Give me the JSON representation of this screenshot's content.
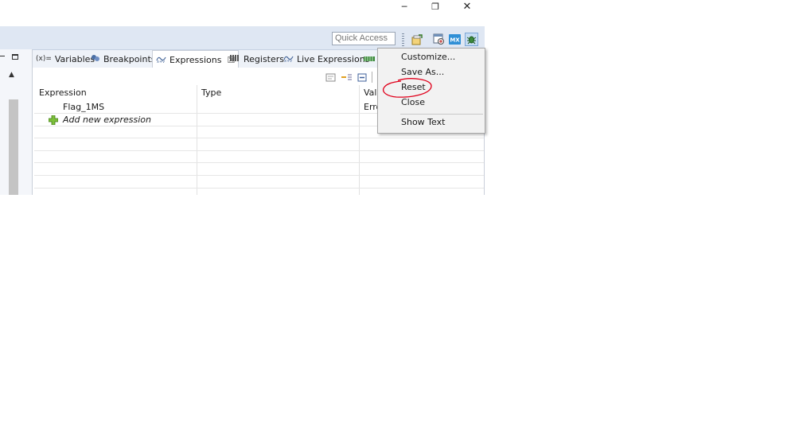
{
  "window": {
    "minimize_glyph": "─",
    "restore_glyph": "❐",
    "close_glyph": "✕"
  },
  "toolbar": {
    "quick_access_placeholder": "Quick Access"
  },
  "tabs": [
    {
      "prefix": "(x)=",
      "label": "Variables"
    },
    {
      "label": "Breakpoints"
    },
    {
      "label": "Expressions",
      "close_glyph": "☒"
    },
    {
      "label": "Registers"
    },
    {
      "label": "Live Expressions"
    }
  ],
  "table": {
    "headers": [
      "Expression",
      "Type",
      "Valu"
    ],
    "rows": [
      {
        "expression": "Flag_1MS",
        "type": "",
        "value": "Erro"
      }
    ],
    "add_new": "Add new expression"
  },
  "menu": {
    "items": [
      "Customize...",
      "Save As...",
      "Reset",
      "Close",
      "Show Text"
    ]
  },
  "colors": {
    "annotation": "#e0001b",
    "accent": "#2f7fd1"
  }
}
